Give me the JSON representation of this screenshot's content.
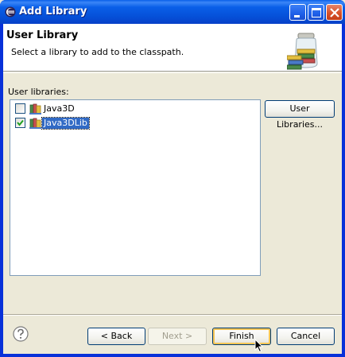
{
  "window": {
    "title": "Add Library"
  },
  "header": {
    "title": "User Library",
    "description": "Select a library to add to the classpath."
  },
  "list": {
    "label": "User libraries:",
    "items": [
      {
        "label": "Java3D",
        "checked": false,
        "selected": false,
        "icon": "library-icon"
      },
      {
        "label": "Java3DLib",
        "checked": true,
        "selected": true,
        "icon": "library-icon"
      }
    ]
  },
  "buttons": {
    "user_libraries": "User Libraries...",
    "back": "< Back",
    "next": "Next >",
    "finish": "Finish",
    "cancel": "Cancel"
  },
  "colors": {
    "titlebar": "#0A5FE8",
    "selection": "#316AC5",
    "dialog_bg": "#ECE9D8"
  }
}
